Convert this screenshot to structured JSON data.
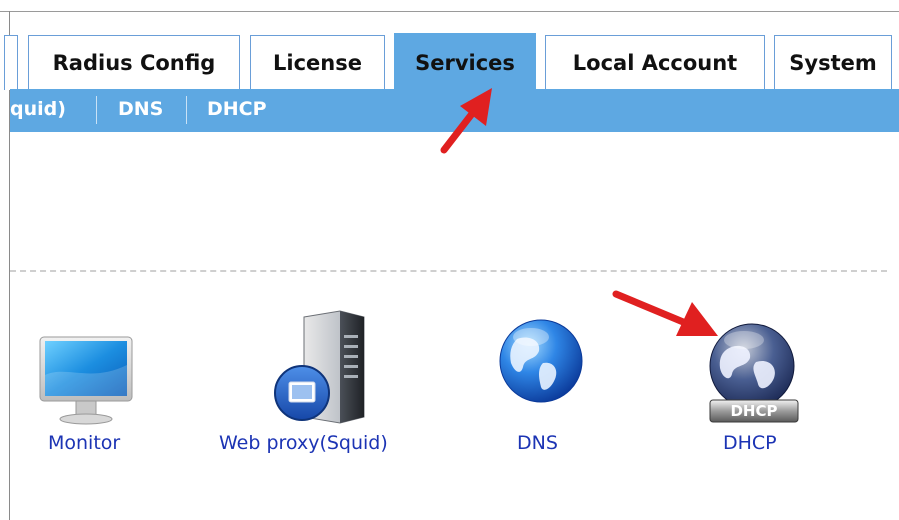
{
  "tabs": [
    {
      "label": "Radius Config",
      "active": false
    },
    {
      "label": "License",
      "active": false
    },
    {
      "label": "Services",
      "active": true
    },
    {
      "label": "Local Account",
      "active": false
    },
    {
      "label": "System",
      "active": false
    }
  ],
  "subnav": [
    {
      "label": "quid)"
    },
    {
      "label": "DNS"
    },
    {
      "label": "DHCP"
    }
  ],
  "services": [
    {
      "label": "Monitor",
      "icon": "monitor-icon"
    },
    {
      "label": "Web proxy(Squid)",
      "icon": "server-icon"
    },
    {
      "label": "DNS",
      "icon": "globe-icon"
    },
    {
      "label": "DHCP",
      "icon": "dhcp-globe-icon",
      "badge": "DHCP"
    }
  ],
  "annotations": [
    {
      "icon": "red-arrow-icon",
      "points_to": "Services tab"
    },
    {
      "icon": "red-arrow-icon",
      "points_to": "DHCP icon"
    }
  ],
  "colors": {
    "accent": "#5ea8e2",
    "link": "#1c34b4",
    "arrow": "#e02020"
  }
}
